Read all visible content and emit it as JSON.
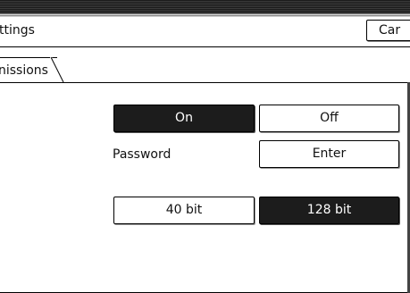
{
  "header": {
    "title": "ttings",
    "cancel_label": "Car"
  },
  "tabs": [
    {
      "label": "nissions",
      "active": true
    }
  ],
  "encryption": {
    "on_label": "On",
    "off_label": "Off",
    "selected": "On"
  },
  "password": {
    "label": "Password",
    "enter_label": "Enter"
  },
  "key_length": {
    "option_40": "40 bit",
    "option_128": "128 bit",
    "selected": "128 bit"
  },
  "colors": {
    "selected_bg": "#1c1c1c",
    "selected_text": "#ffffff",
    "button_bg": "#ffffff",
    "border": "#000000"
  }
}
